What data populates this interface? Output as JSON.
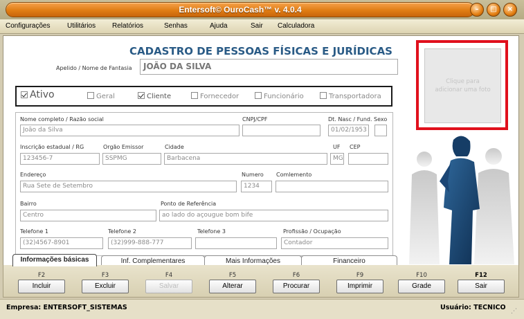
{
  "window": {
    "title": "Entersoft© OuroCash™ v. 4.0.4"
  },
  "menu": [
    "Configurações",
    "Utilitários",
    "Relatórios",
    "Senhas",
    "Ajuda",
    "Sair",
    "Calculadora"
  ],
  "form": {
    "title": "CADASTRO DE PESSOAS FÍSICAS E JURÍDICAS",
    "apelido_label": "Apelido / Nome de Fantasia",
    "apelido_value": "JOÃO DA SILVA"
  },
  "status_flags": [
    {
      "label": "Ativo",
      "checked": true
    },
    {
      "label": "Geral",
      "checked": false
    },
    {
      "label": "Cliente",
      "checked": true
    },
    {
      "label": "Fornecedor",
      "checked": false
    },
    {
      "label": "Funcionário",
      "checked": false
    },
    {
      "label": "Transportadora",
      "checked": false
    }
  ],
  "fields": {
    "nome": {
      "label": "Nome completo / Razão social",
      "value": "João da Silva"
    },
    "cnpj": {
      "label": "CNPJ/CPF",
      "value": ""
    },
    "nasc": {
      "label": "Dt. Nasc / Fund.",
      "value": "01/02/1953"
    },
    "sexo": {
      "label": "Sexo",
      "value": ""
    },
    "ie": {
      "label": "Inscrição estadual / RG",
      "value": "123456-7"
    },
    "orgao": {
      "label": "Orgão Emissor",
      "value": "SSPMG"
    },
    "cidade": {
      "label": "Cidade",
      "value": "Barbacena"
    },
    "uf": {
      "label": "UF",
      "value": "MG"
    },
    "cep": {
      "label": "CEP",
      "value": ""
    },
    "endereco": {
      "label": "Endereço",
      "value": "Rua Sete de Setembro"
    },
    "numero": {
      "label": "Numero",
      "value": "1234"
    },
    "complemento": {
      "label": "Comlemento",
      "value": ""
    },
    "bairro": {
      "label": "Bairro",
      "value": "Centro"
    },
    "referencia": {
      "label": "Ponto de Referência",
      "value": "ao lado do açougue bom bife"
    },
    "tel1": {
      "label": "Telefone 1",
      "value": "(32)4567-8901"
    },
    "tel2": {
      "label": "Telefone 2",
      "value": "(32)999-888-777"
    },
    "tel3": {
      "label": "Telefone 3",
      "value": ""
    },
    "profissao": {
      "label": "Profissão / Ocupação",
      "value": "Contador"
    }
  },
  "photo": {
    "hint": "Clique para adicionar uma foto"
  },
  "tabs": [
    "Informações básicas",
    "Inf. Complementares",
    "Mais Informações",
    "Financeiro"
  ],
  "function_keys": [
    {
      "key": "F2",
      "label": "Incluir",
      "enabled": true
    },
    {
      "key": "F3",
      "label": "Excluir",
      "enabled": true
    },
    {
      "key": "F4",
      "label": "Salvar",
      "enabled": false
    },
    {
      "key": "F5",
      "label": "Alterar",
      "enabled": true
    },
    {
      "key": "F6",
      "label": "Procurar",
      "enabled": true
    },
    {
      "key": "F9",
      "label": "Imprimir",
      "enabled": true
    },
    {
      "key": "F10",
      "label": "Grade",
      "enabled": true
    },
    {
      "key": "F12",
      "label": "Sair",
      "enabled": true
    }
  ],
  "statusbar": {
    "empresa": "Empresa: ENTERSOFT_SISTEMAS",
    "usuario": "Usuário: TECNICO"
  },
  "colors": {
    "title_orange": "#e07d14",
    "form_title": "#2a5b86",
    "photo_border": "#e0101c",
    "silhouette": "#1f4f7a"
  }
}
